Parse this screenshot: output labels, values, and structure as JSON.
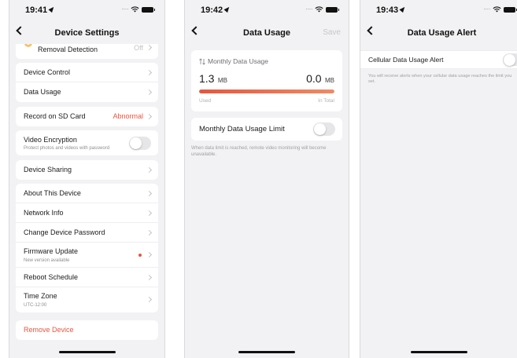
{
  "colors": {
    "accent": "#e8553f",
    "background": "#f2f2f4"
  },
  "screen1": {
    "time": "19:41",
    "title": "Device Settings",
    "removal_label": "Removal Detection",
    "removal_value": "Off",
    "device_control": "Device Control",
    "data_usage": "Data Usage",
    "record_sd": "Record on SD Card",
    "record_sd_value": "Abnormal",
    "video_encryption": "Video Encryption",
    "video_encryption_sub": "Protect photos and videos with password",
    "device_sharing": "Device Sharing",
    "about_device": "About This Device",
    "network_info": "Network Info",
    "change_password": "Change Device Password",
    "firmware_update": "Firmware Update",
    "firmware_sub": "New version available",
    "reboot_schedule": "Reboot Schedule",
    "time_zone": "Time Zone",
    "time_zone_sub": "UTC-12:00",
    "remove_device": "Remove Device"
  },
  "screen2": {
    "time": "19:42",
    "title": "Data Usage",
    "save": "Save",
    "monthly_label": "Monthly Data Usage",
    "used_value": "1.3",
    "used_unit": "MB",
    "total_value": "0.0",
    "total_unit": "MB",
    "used_label": "Used",
    "total_label": "In Total",
    "usage_fraction": 1.0,
    "limit_label": "Monthly Data Usage Limit",
    "limit_hint": "When data limit is reached, remote video monitoring will become unavailable."
  },
  "screen3": {
    "time": "19:43",
    "title": "Data Usage Alert",
    "alert_label": "Cellular Data Usage Alert",
    "alert_hint": "You will receive alerts when your cellular data usage reaches the limit you set."
  }
}
